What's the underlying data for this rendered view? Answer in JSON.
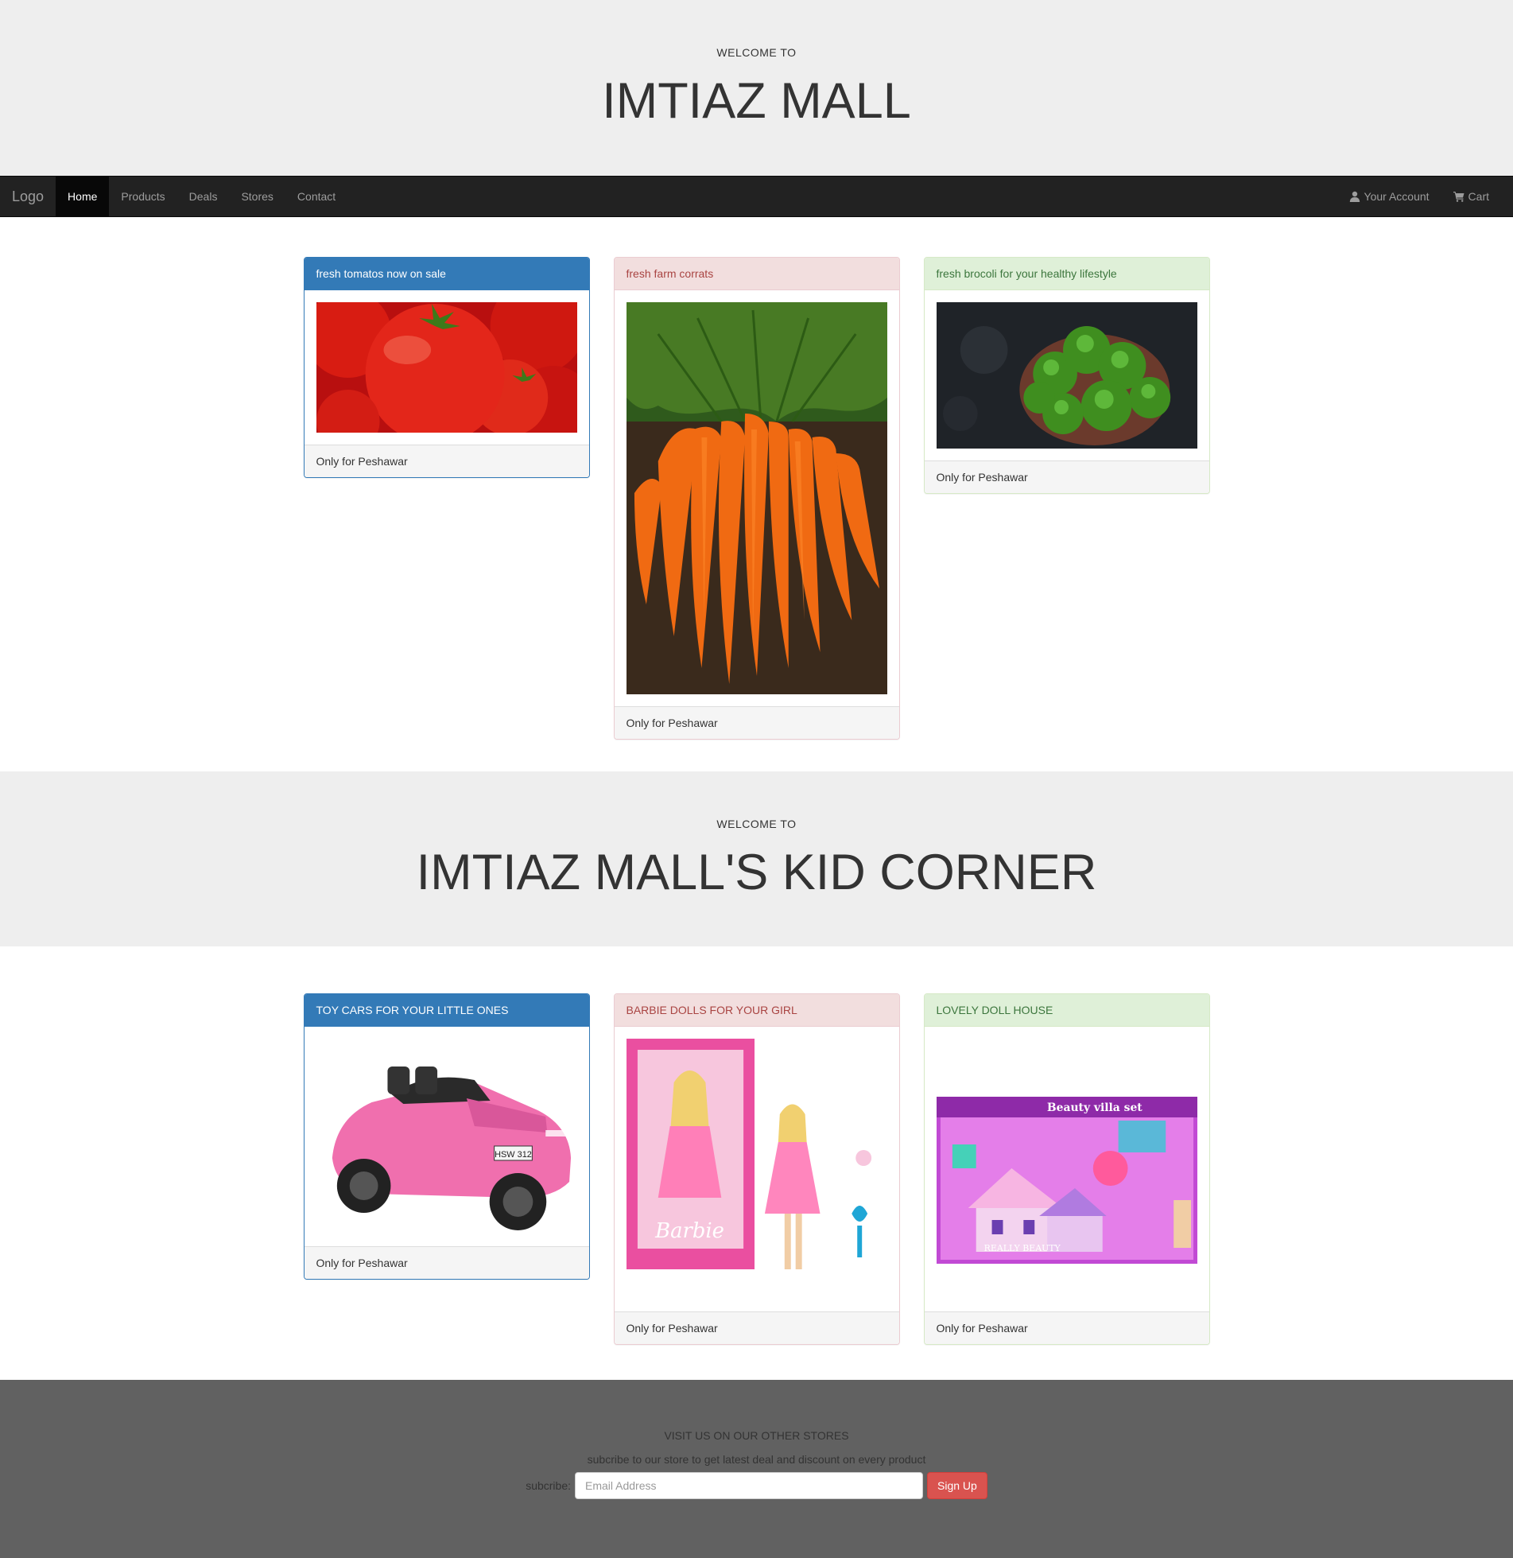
{
  "header": {
    "eyebrow": "WELCOME TO",
    "title": "IMTIAZ MALL"
  },
  "navbar": {
    "brand": "Logo",
    "links": [
      "Home",
      "Products",
      "Deals",
      "Stores",
      "Contact"
    ],
    "active": "Home",
    "account_label": "Your Account",
    "account_icon": "user-icon",
    "cart_label": "Cart",
    "cart_icon": "cart-icon"
  },
  "products": [
    {
      "heading": "fresh tomatos now on sale",
      "footer": "Only for Peshawar",
      "style": "primary",
      "image": "tomatoes-image"
    },
    {
      "heading": "fresh farm corrats",
      "footer": "Only for Peshawar",
      "style": "danger",
      "image": "carrots-image"
    },
    {
      "heading": "fresh brocoli for your healthy lifestyle",
      "footer": "Only for Peshawar",
      "style": "success",
      "image": "broccoli-image"
    }
  ],
  "kids_header": {
    "eyebrow": "WELCOME TO",
    "title": "IMTIAZ MALL'S KID CORNER"
  },
  "kids_products": [
    {
      "heading": "TOY CARS FOR YOUR LITTLE ONES",
      "footer": "Only for Peshawar",
      "style": "primary",
      "image": "toy-car-image"
    },
    {
      "heading": "BARBIE DOLLS FOR YOUR GIRL",
      "footer": "Only for Peshawar",
      "style": "danger",
      "image": "barbie-doll-image"
    },
    {
      "heading": "LOVELY DOLL HOUSE",
      "footer": "Only for Peshawar",
      "style": "success",
      "image": "doll-house-image"
    }
  ],
  "footer": {
    "title": "VISIT US ON OUR OTHER STORES",
    "subtitle": "subcribe to our store to get latest deal and discount on every product",
    "label": "subcribe:",
    "placeholder": "Email Address",
    "button": "Sign Up"
  },
  "colors": {
    "primary": "#337ab7",
    "danger_bg": "#f2dede",
    "success_bg": "#dff0d8",
    "navbar_bg": "#222222",
    "footer_bg": "#616161",
    "signup_button": "#d9534f"
  }
}
